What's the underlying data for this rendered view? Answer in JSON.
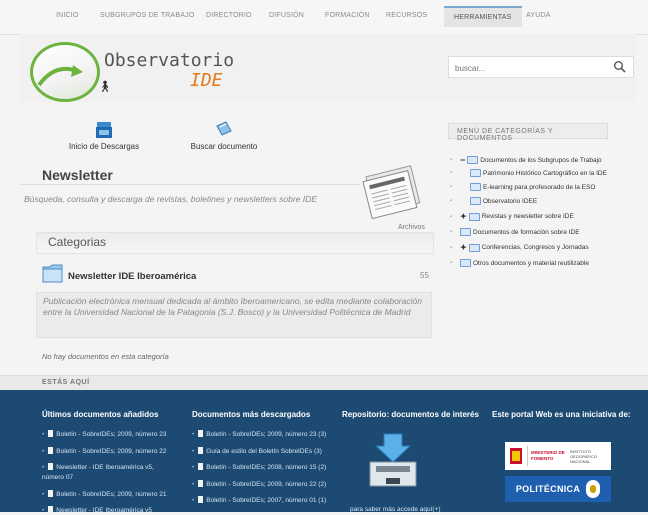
{
  "nav": {
    "items": [
      "INICIO",
      "SUBGRUPOS DE TRABAJO",
      "DIRECTORIO",
      "DIFUSIÓN",
      "FORMACIÓN",
      "RECURSOS",
      "HERRAMIENTAS",
      "AYUDA"
    ],
    "active": "HERRAMIENTAS"
  },
  "logo": {
    "name": "Observatorio",
    "ide": "IDE"
  },
  "search": {
    "placeholder": "buscar..."
  },
  "toolbar": {
    "downloads": "Inicio de Descargas",
    "find": "Buscar documento"
  },
  "newsletter": {
    "title": "Newsletter",
    "description": "Búsqueda, consulta y descarga de revistas, boletines y newsletters sobre IDE",
    "archivos": "Archivos"
  },
  "categories": {
    "heading": "Categorias",
    "item_title": "Newsletter IDE Iberoamérica",
    "item_count": "55",
    "item_desc": "Publicación electrónica mensual dedicada al ámbito Iberoamericano, se edita mediante colaboración entre la Universidad Nacional de la Patagonia (S.J. Bosco) y la Universidad Politécnica de Madrid",
    "empty": "No hay documentos en esta categoría"
  },
  "sidebar": {
    "heading": "MENÚ DE CATEGORÍAS Y DOCUMENTOS",
    "items": [
      "Documentos de los Subgrupos de Trabajo",
      "Patrimonio Histórico Cartográfico en la IDE",
      "E-learning para profesorado de la ESO",
      "Observatorio IDEE",
      "Revistas y newsletter sobre IDE",
      "Documentos de formación sobre IDE",
      "Conferencias, Congresos y Jornadas",
      "Otros documentos y material reutilizable"
    ]
  },
  "breadcrumb": {
    "label": "ESTÁS AQUÍ"
  },
  "footer": {
    "col1_title": "Últimos documentos añadidos",
    "col1": [
      "Boletín - SobreIDEs; 2009, número 23",
      "Boletín - SobreIDEs; 2009, número 22",
      "Newsletter - IDE Iberoamérica v5,",
      "número 07",
      "Boletín - SobreIDEs; 2009, número 21",
      "Newsletter - IDE Iberoamérica v5"
    ],
    "col2_title": "Documentos más descargados",
    "col2": [
      "Boletín - SobreIDEs; 2009, número 23 (3)",
      "Guía de estilo del Boletín SobreIDEs (3)",
      "Boletín - SobreIDEs; 2008, número 15 (2)",
      "Boletín - SobreIDEs; 2009, número 22 (2)",
      "Boletín - SobreIDEs; 2007, número 01 (1)"
    ],
    "col3_title": "Repositorio: documentos de interés",
    "col3_link": "para saber más accede aquí(+)",
    "col4_title": "Este portal Web es una iniciativa de:",
    "ministerio": "MINISTERIO DE FOMENTO",
    "instituto": "INSTITUTO GEOGRÁFICO NACIONAL",
    "politecnica": "POLITÉCNICA"
  }
}
